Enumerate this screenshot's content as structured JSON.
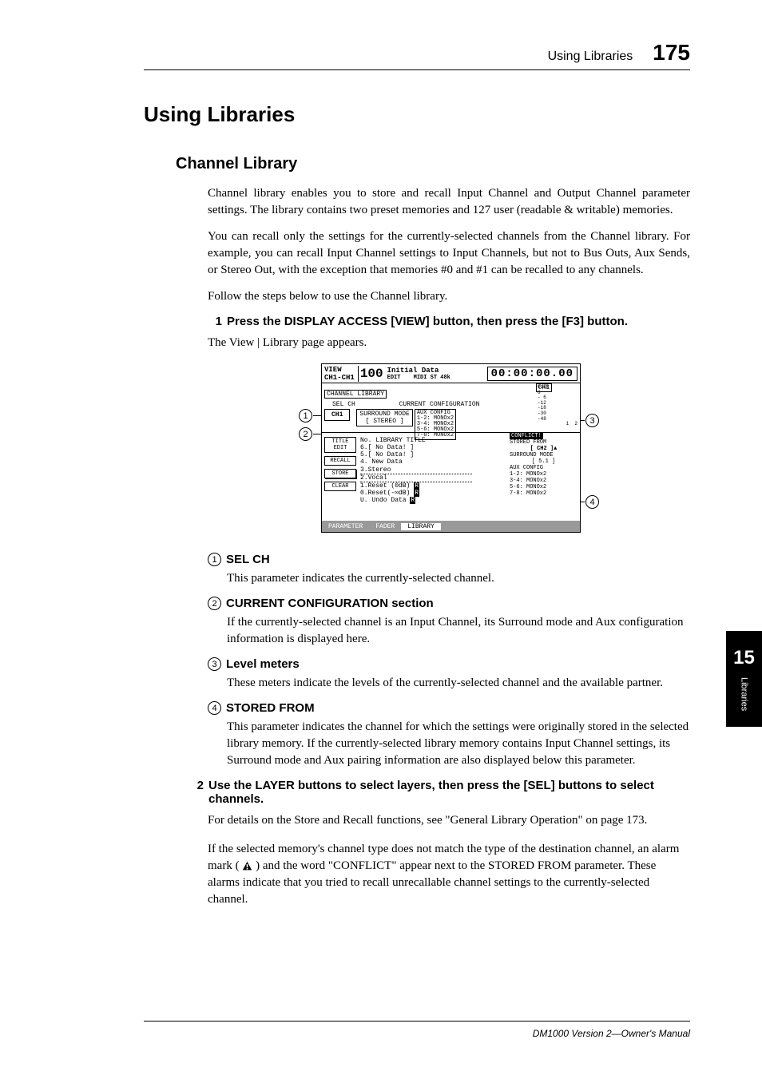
{
  "header": {
    "title": "Using Libraries",
    "page": "175"
  },
  "h1": "Using Libraries",
  "h2": "Channel Library",
  "p1": "Channel library enables you to store and recall Input Channel and Output Channel parameter settings. The library contains two preset memories and 127 user (readable & writable) memories.",
  "p2": "You can recall only the settings for the currently-selected channels from the Channel library. For example, you can recall Input Channel settings to Input Channels, but not to Bus Outs, Aux Sends, or Stereo Out, with the exception that memories #0 and #1 can be recalled to any channels.",
  "p3": "Follow the steps below to use the Channel library.",
  "step1": {
    "num": "1",
    "title": "Press the DISPLAY ACCESS [VIEW] button, then press the [F3] button.",
    "body": "The View | Library page appears."
  },
  "screenshot": {
    "view_label": "VIEW",
    "ch_label": "CH1-CH1",
    "init_data": "Initial Data",
    "edit": "EDIT",
    "midi_st": "MIDI ST 48k",
    "timecode": "00:00:00.00",
    "ch_library": "CHANNEL LIBRARY",
    "ch1": "CH1",
    "sel_ch": "SEL CH",
    "curr_config": "CURRENT CONFIGURATION",
    "surround_mode": "SURROUND MODE",
    "stereo": "STEREO",
    "aux_config": "AUX CONFIG",
    "aux_lines": [
      "1-2: MONOx2",
      "3-4: MONOx2",
      "5-6: MONOx2",
      "7-8: MONOx2"
    ],
    "meter_labels": [
      "OVER",
      "0",
      "- 6",
      "-12",
      "-18",
      "-30",
      "-48"
    ],
    "meter_ch": [
      "1",
      "2"
    ],
    "title_edit": "TITLE EDIT",
    "recall": "RECALL",
    "store": "STORE",
    "clear": "CLEAR",
    "list_header": "No.   LIBRARY TITLE",
    "list_items": [
      "6.[   No Data!   ]",
      "5.[   No Data!   ]",
      "4.    New Data",
      "3.Stereo",
      "2.Vocal",
      "1.Reset (0dB)",
      "0.Reset(-∞dB)",
      "U.    Undo Data"
    ],
    "conflict": "CONFLICT!",
    "stored_from": "STORED FROM",
    "ch2": "CH2",
    "surround_mode2": "SURROUND MODE",
    "mode_51": "5.1",
    "aux_config2": "AUX CONFIG",
    "tabs": {
      "parameter": "PARAMETER",
      "fader": "FADER",
      "library": "LIBRARY"
    }
  },
  "defs": [
    {
      "num": "1",
      "title": "SEL CH",
      "body": "This parameter indicates the currently-selected channel."
    },
    {
      "num": "2",
      "title": "CURRENT CONFIGURATION section",
      "body": "If the currently-selected channel is an Input Channel, its Surround mode and Aux configuration information is displayed here."
    },
    {
      "num": "3",
      "title": "Level meters",
      "body": "These meters indicate the levels of the currently-selected channel and the available partner."
    },
    {
      "num": "4",
      "title": "STORED FROM",
      "body": "This parameter indicates the channel for which the settings were originally stored in the selected library memory. If the currently-selected library memory contains Input Channel settings, its Surround mode and Aux pairing information are also displayed below this parameter."
    }
  ],
  "step2": {
    "num": "2",
    "title": "Use the LAYER buttons to select layers, then press the [SEL] buttons to select channels.",
    "body1": "For details on the Store and Recall functions, see \"General Library Operation\" on page 173.",
    "body2a": "If the selected memory's channel type does not match the type of the destination channel, an alarm mark (",
    "body2b": ") and the word \"CONFLICT\" appear next to the STORED FROM parameter. These alarms indicate that you tried to recall unrecallable channel settings to the currently-selected channel."
  },
  "side_tab": {
    "num": "15",
    "label": "Libraries"
  },
  "footer": "DM1000 Version 2—Owner's Manual"
}
